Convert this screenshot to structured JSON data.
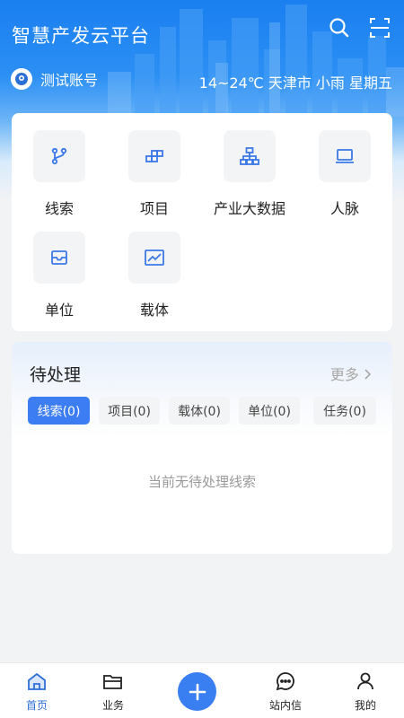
{
  "header": {
    "title": "智慧产发云平台",
    "account_name": "测试账号",
    "weather": "14~24℃ 天津市 小雨 星期五"
  },
  "functions": [
    {
      "label": "线索",
      "icon": "branch-icon"
    },
    {
      "label": "项目",
      "icon": "blocks-icon"
    },
    {
      "label": "产业大数据",
      "icon": "org-chart-icon"
    },
    {
      "label": "人脉",
      "icon": "laptop-icon"
    },
    {
      "label": "单位",
      "icon": "inbox-icon"
    },
    {
      "label": "载体",
      "icon": "chart-line-icon"
    }
  ],
  "todo": {
    "title": "待处理",
    "more": "更多",
    "tabs": [
      {
        "label": "线索(0)",
        "active": true
      },
      {
        "label": "项目(0)",
        "active": false
      },
      {
        "label": "载体(0)",
        "active": false
      },
      {
        "label": "单位(0)",
        "active": false
      },
      {
        "label": "任务(0)",
        "active": false
      }
    ],
    "empty_text": "当前无待处理线索"
  },
  "tabbar": {
    "items": [
      {
        "label": "首页",
        "icon": "home-icon",
        "active": true
      },
      {
        "label": "业务",
        "icon": "folder-icon",
        "active": false
      },
      {
        "label": "",
        "icon": "plus-icon",
        "active": false
      },
      {
        "label": "站内信",
        "icon": "message-icon",
        "active": false
      },
      {
        "label": "我的",
        "icon": "user-icon",
        "active": false
      }
    ]
  },
  "colors": {
    "accent": "#3d7df4",
    "header_blue": "#1a7ff0",
    "icon_blue": "#3b78e7"
  }
}
